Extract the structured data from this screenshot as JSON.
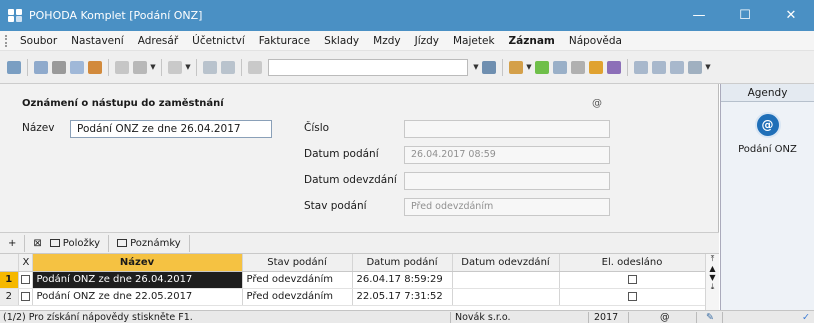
{
  "window": {
    "title": "POHODA Komplet  [Podání ONZ]",
    "minimize": "—",
    "maximize": "☐",
    "close": "✕"
  },
  "menu": [
    {
      "label": "Soubor"
    },
    {
      "label": "Nastavení"
    },
    {
      "label": "Adresář"
    },
    {
      "label": "Účetnictví"
    },
    {
      "label": "Fakturace"
    },
    {
      "label": "Sklady"
    },
    {
      "label": "Mzdy"
    },
    {
      "label": "Jízdy"
    },
    {
      "label": "Majetek"
    },
    {
      "label": "Záznam"
    },
    {
      "label": "Nápověda"
    }
  ],
  "form": {
    "title": "Oznámení o nástupu do zaměstnání",
    "icon": "@",
    "nazev_label": "Název",
    "nazev_value": "Podání ONZ ze dne 26.04.2017",
    "cislo_label": "Číslo",
    "cislo_value": "",
    "datum_podani_label": "Datum podání",
    "datum_podani_value": "26.04.2017 08:59",
    "datum_odevzdani_label": "Datum odevzdání",
    "datum_odevzdani_value": "",
    "stav_label": "Stav podání",
    "stav_value": "Před odevzdáním"
  },
  "agendy": {
    "header": "Agendy",
    "item_label": "Podání ONZ",
    "item_icon": "onz-icon",
    "accent": "#1f6fb8"
  },
  "tabs": {
    "plus": "+",
    "polozky": "Položky",
    "poznamky": "Poznámky"
  },
  "table": {
    "headers": {
      "x": "X",
      "nazev": "Název",
      "stav": "Stav podání",
      "datum_podani": "Datum podání",
      "datum_odevzdani": "Datum odevzdání",
      "odeslano": "El. odesláno"
    },
    "rows": [
      {
        "num": "1",
        "nazev": "Podání ONZ ze dne 26.04.2017",
        "stav": "Před odevzdáním",
        "datum_podani": "26.04.17 8:59:29",
        "datum_odevzdani": "",
        "odeslano": false
      },
      {
        "num": "2",
        "nazev": "Podání ONZ ze dne 22.05.2017",
        "stav": "Před odevzdáním",
        "datum_podani": "22.05.17 7:31:52",
        "datum_odevzdani": "",
        "odeslano": false
      }
    ]
  },
  "status": {
    "hint": "(1/2) Pro získání nápovědy stiskněte F1.",
    "company": "Novák s.r.o.",
    "year": "2017",
    "at": "@",
    "pen": "✎",
    "check": "✓"
  }
}
